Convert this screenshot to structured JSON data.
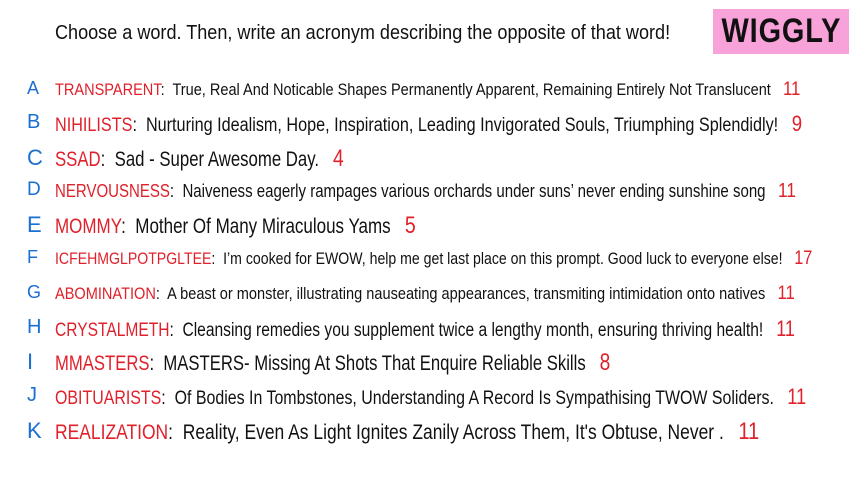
{
  "header": {
    "instruction": "Choose a word. Then, write an acronym describing the opposite of that word!",
    "logo": "WIGGLY"
  },
  "colors": {
    "letter": "#1a6fd0",
    "word": "#e0202a",
    "logo_bg": "#f7a3d9"
  },
  "entries": [
    {
      "letter": "A",
      "word": "TRANSPARENT",
      "definition": "True, Real And Noticable Shapes Permanently Apparent, Remaining Entirely Not Translucent",
      "score": "11"
    },
    {
      "letter": "B",
      "word": "NIHILISTS",
      "definition": "Nurturing Idealism, Hope, Inspiration, Leading Invigorated Souls, Triumphing Splendidly!",
      "score": "9"
    },
    {
      "letter": "C",
      "word": "SSAD",
      "definition": "Sad - Super Awesome Day.",
      "score": "4"
    },
    {
      "letter": "D",
      "word": "NERVOUSNESS",
      "definition": "Naiveness eagerly rampages various orchards under suns’ never ending sunshine song",
      "score": "11"
    },
    {
      "letter": "E",
      "word": "MOMMY",
      "definition": "Mother Of Many Miraculous Yams",
      "score": "5"
    },
    {
      "letter": "F",
      "word": "ICFEHMGLPOTPGLTEE",
      "definition": "I’m cooked for EWOW, help me get last place on this prompt. Good luck to everyone else!",
      "score": "17"
    },
    {
      "letter": "G",
      "word": "ABOMINATION",
      "definition": "A beast or monster, illustrating nauseating appearances, transmiting intimidation onto natives",
      "score": "11"
    },
    {
      "letter": "H",
      "word": "CRYSTALMETH",
      "definition": "Cleansing remedies you supplement twice a lengthy month, ensuring thriving health!",
      "score": "11"
    },
    {
      "letter": "I",
      "word": "MMASTERS",
      "definition": "MASTERS- Missing At Shots That Enquire Reliable Skills",
      "score": "8"
    },
    {
      "letter": "J",
      "word": "OBITUARISTS",
      "definition": "Of Bodies In Tombstones, Understanding A Record Is Sympathising TWOW Soliders.",
      "score": "11"
    },
    {
      "letter": "K",
      "word": "REALIZATION",
      "definition": "Reality, Even As Light Ignites Zanily Across Them, It's Obtuse, Never .",
      "score": "11"
    }
  ]
}
